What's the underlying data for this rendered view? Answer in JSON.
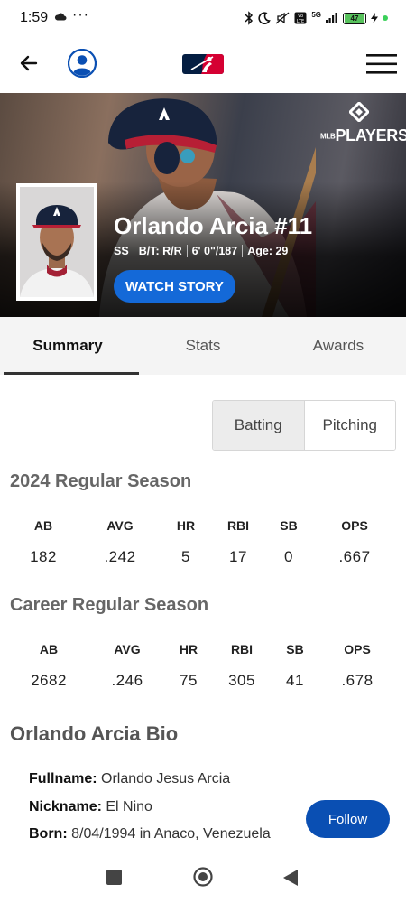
{
  "status_bar": {
    "time": "1:59",
    "dots": "···",
    "battery_level": "47",
    "network": "5G"
  },
  "header": {
    "back_icon": "arrow-left-icon",
    "profile_icon": "account-circle-icon",
    "logo": "mlb-logo",
    "menu_icon": "hamburger-menu-icon"
  },
  "hero": {
    "brand": "PLAYERS",
    "brand_small": "MLB",
    "player_name": "Orlando Arcia #11",
    "position": "SS",
    "bats_throws": "B/T: R/R",
    "height_weight": "6' 0\"/187",
    "age": "Age: 29",
    "watch_button": "WATCH STORY"
  },
  "tabs": [
    {
      "label": "Summary",
      "active": true
    },
    {
      "label": "Stats",
      "active": false
    },
    {
      "label": "Awards",
      "active": false
    }
  ],
  "stat_toggle": {
    "batting": "Batting",
    "pitching": "Pitching",
    "selected": "Batting"
  },
  "season": {
    "title": "2024 Regular Season",
    "headers": [
      "AB",
      "AVG",
      "HR",
      "RBI",
      "SB",
      "OPS"
    ],
    "values": [
      "182",
      ".242",
      "5",
      "17",
      "0",
      ".667"
    ]
  },
  "career": {
    "title": "Career Regular Season",
    "headers": [
      "AB",
      "AVG",
      "HR",
      "RBI",
      "SB",
      "OPS"
    ],
    "values": [
      "2682",
      ".246",
      "75",
      "305",
      "41",
      ".678"
    ]
  },
  "bio": {
    "title": "Orlando Arcia Bio",
    "fullname_label": "Fullname:",
    "fullname": "Orlando Jesus Arcia",
    "nickname_label": "Nickname:",
    "nickname": "El Nino",
    "born_label": "Born:",
    "born": "8/04/1994 in Anaco, Venezuela",
    "follow_button": "Follow"
  },
  "colors": {
    "accent_blue": "#1469d8",
    "follow_blue": "#0a4fb3",
    "mlb_red": "#d50032",
    "mlb_blue": "#041e42"
  }
}
